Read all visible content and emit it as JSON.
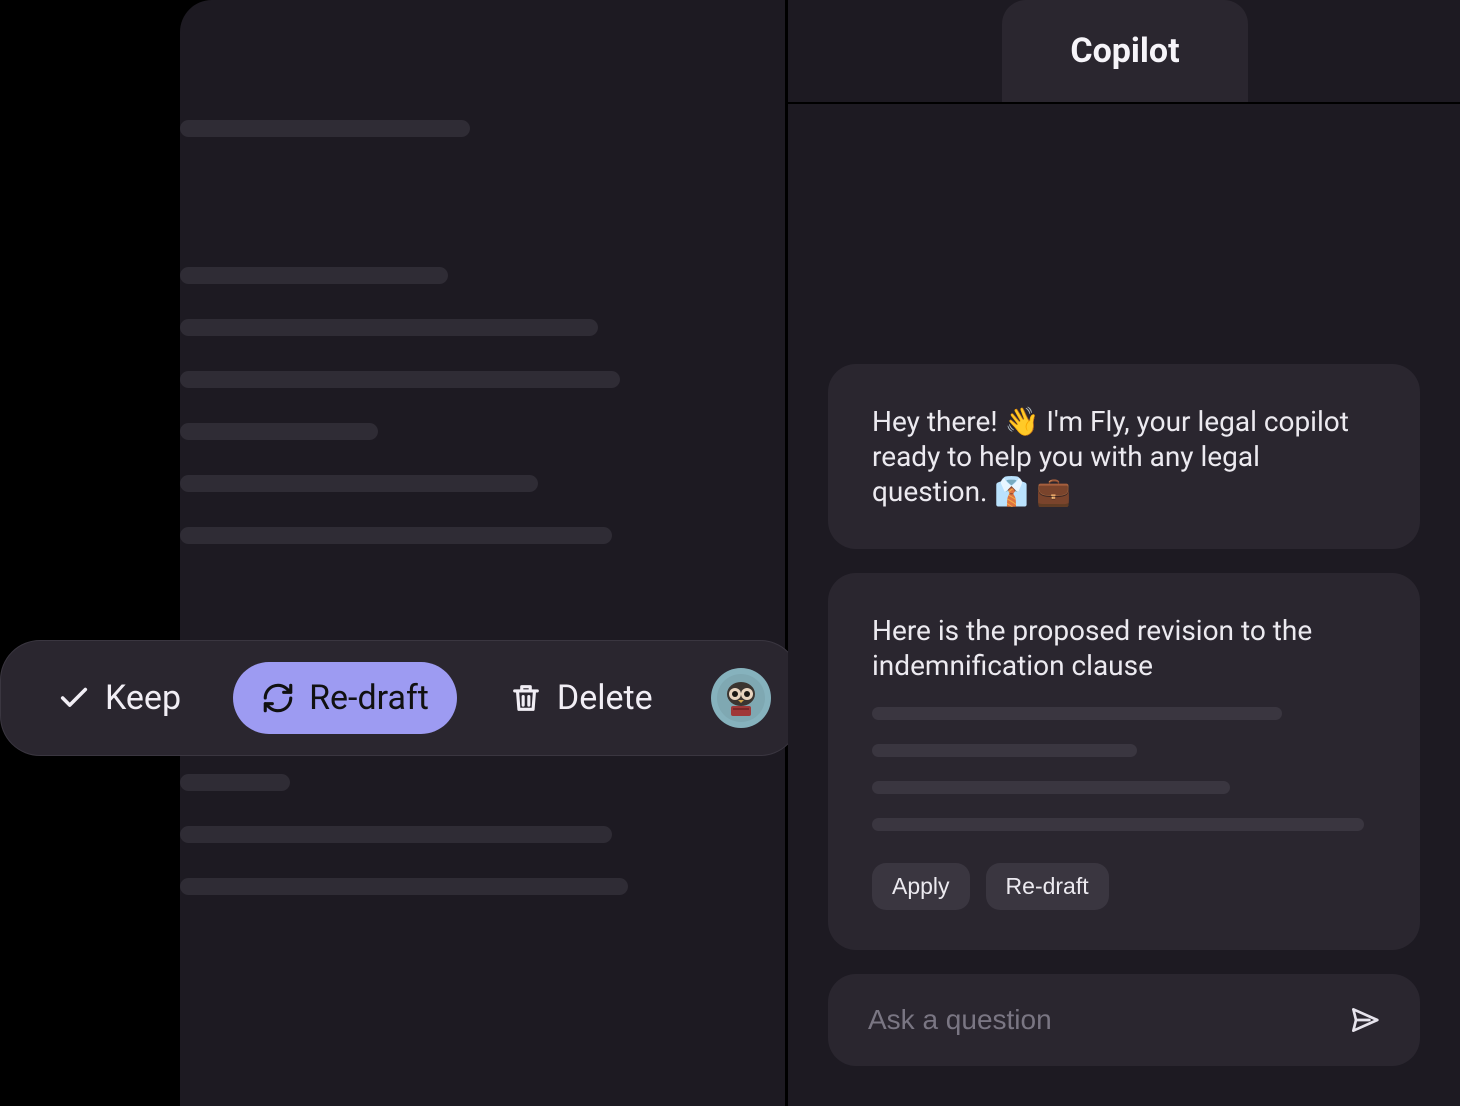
{
  "copilot": {
    "tab_label": "Copilot"
  },
  "toolbar": {
    "keep_label": "Keep",
    "redraft_label": "Re-draft",
    "delete_label": "Delete"
  },
  "chat": {
    "intro_message": "Hey there! 👋 I'm Fly, your legal copilot ready to help you with any legal question. 👔 💼",
    "revision_message": "Here is the proposed revision to the indemnification clause",
    "apply_label": "Apply",
    "redraft_label": "Re-draft",
    "input_placeholder": "Ask a question"
  }
}
